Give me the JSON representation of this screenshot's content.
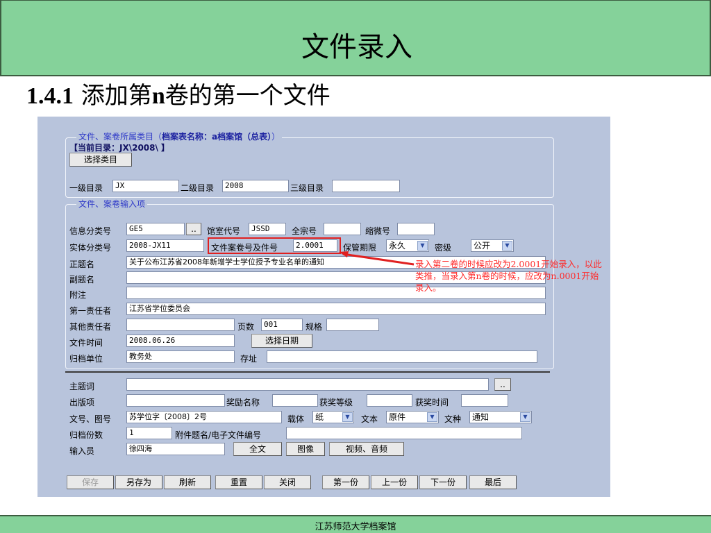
{
  "slide": {
    "title": "文件录入",
    "subtitle_num": "1.4.1",
    "subtitle_text": "添加第",
    "subtitle_n": "n",
    "subtitle_rest": "卷的第一个文件",
    "footer": "江苏师范大学档案馆"
  },
  "app": {
    "category_legend": "文件、案卷所属类目（",
    "category_legend_bold": "档案表名称：a档案馆（总表）",
    "category_legend_end": "）",
    "current_dir": "【当前目录：JX\\2008\\  】",
    "select_category_btn": "选择类目",
    "level1_label": "一级目录",
    "level1_value": "JX",
    "level2_label": "二级目录",
    "level2_value": "2008",
    "level3_label": "三级目录",
    "level3_value": "",
    "input_legend": "文件、案卷输入项",
    "info_class_label": "信息分类号",
    "info_class_value": "GE5",
    "dots_btn": "..",
    "room_code_label": "馆室代号",
    "room_code_value": "JSSD",
    "fonds_label": "全宗号",
    "fonds_value": "",
    "microfilm_label": "缩微号",
    "microfilm_value": "",
    "entity_class_label": "实体分类号",
    "entity_class_value": "2008-JX11",
    "file_no_label": "文件案卷号及件号",
    "file_no_value": "2.0001",
    "retention_label": "保管期限",
    "retention_value": "永久",
    "secret_label": "密级",
    "secret_value": "公开",
    "title_label": "正题名",
    "title_value": "关于公布江苏省2008年新增学士学位授予专业名单的通知",
    "subtitle_label": "副题名",
    "note_label": "附注",
    "first_resp_label": "第一责任者",
    "first_resp_value": "江苏省学位委员会",
    "other_resp_label": "其他责任者",
    "pages_label": "页数",
    "pages_value": "001",
    "spec_label": "规格",
    "file_time_label": "文件时间",
    "file_time_value": "2008.06.26",
    "select_date_btn": "选择日期",
    "archive_unit_label": "归档单位",
    "archive_unit_value": "教务处",
    "location_label": "存址",
    "subject_label": "主题词",
    "publish_label": "出版项",
    "award_name_label": "奖励名称",
    "award_level_label": "获奖等级",
    "award_time_label": "获奖时间",
    "doc_no_label": "文号、图号",
    "doc_no_value": "苏学位字〔2008〕2号",
    "carrier_label": "载体",
    "carrier_value": "纸",
    "text_label": "文本",
    "text_value": "原件",
    "doc_type_label": "文种",
    "doc_type_value": "通知",
    "copies_label": "归档份数",
    "copies_value": "1",
    "attachment_label": "附件题名/电子文件编号",
    "inputter_label": "输入员",
    "inputter_value": "徐四海",
    "fulltext_btn": "全文",
    "image_btn": "图像",
    "video_btn": "视频、音频",
    "toolbar": {
      "save": "保存",
      "save_as": "另存为",
      "refresh": "刷新",
      "reset": "重置",
      "close": "关闭",
      "first": "第一份",
      "prev": "上一份",
      "next": "下一份",
      "last": "最后"
    },
    "annotation": "录入第二卷的时候应改为2.0001开始录入，以此类推，当录入第n卷的时候，应改为n.0001开始录入。"
  },
  "colors": {
    "title_bar": "#85d29a",
    "panel_bg": "#b8c4dc",
    "annotation": "#ff2a2a"
  }
}
